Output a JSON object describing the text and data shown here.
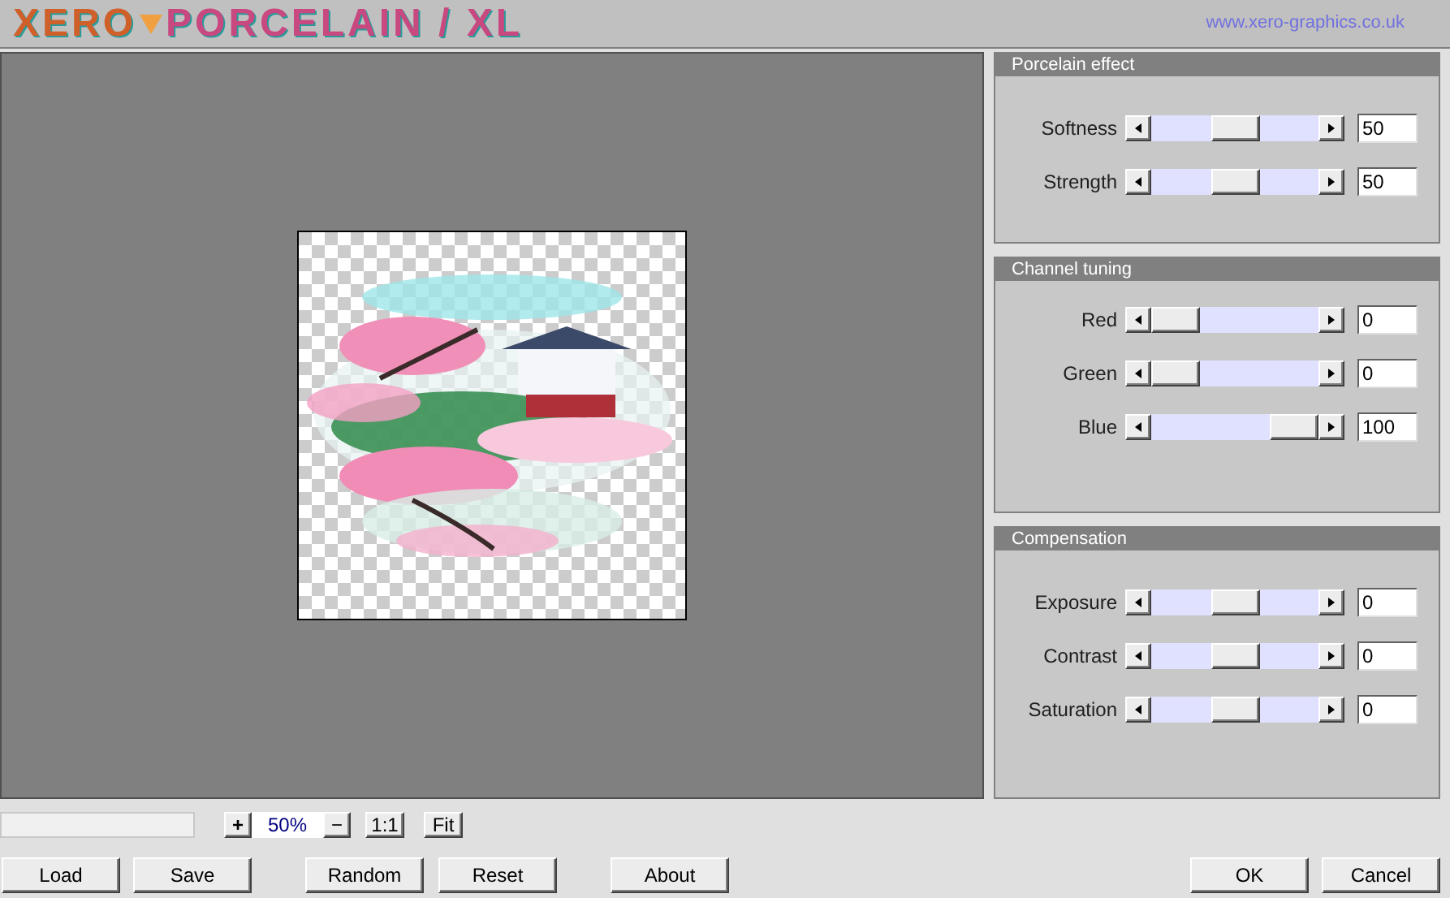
{
  "header": {
    "logo_left": "XERO",
    "logo_right": "PORCELAIN / XL",
    "link": "www.xero-graphics.co.uk"
  },
  "panels": [
    {
      "title": "Porcelain effect",
      "sliders": [
        {
          "label": "Softness",
          "level": 0.5,
          "value": "50"
        },
        {
          "label": "Strength",
          "level": 0.5,
          "value": "50"
        }
      ]
    },
    {
      "title": "Channel tuning",
      "sliders": [
        {
          "label": "Red",
          "level": 0,
          "value": "0"
        },
        {
          "label": "Green",
          "level": 0,
          "value": "0"
        },
        {
          "label": "Blue",
          "level": 1,
          "value": "100"
        }
      ]
    },
    {
      "title": "Compensation",
      "sliders": [
        {
          "label": "Exposure",
          "level": 0.5,
          "value": "0"
        },
        {
          "label": "Contrast",
          "level": 0.5,
          "value": "0"
        },
        {
          "label": "Saturation",
          "level": 0.5,
          "value": "0"
        }
      ]
    }
  ],
  "progress": {
    "level": 0
  },
  "zoom": {
    "plus": "+",
    "value": "50%",
    "minus": "−",
    "one_to_one": "1:1",
    "fit": "Fit"
  },
  "buttons_left": [
    "Load",
    "Save",
    "Random",
    "Reset",
    "About"
  ],
  "buttons_right": [
    "OK",
    "Cancel"
  ]
}
